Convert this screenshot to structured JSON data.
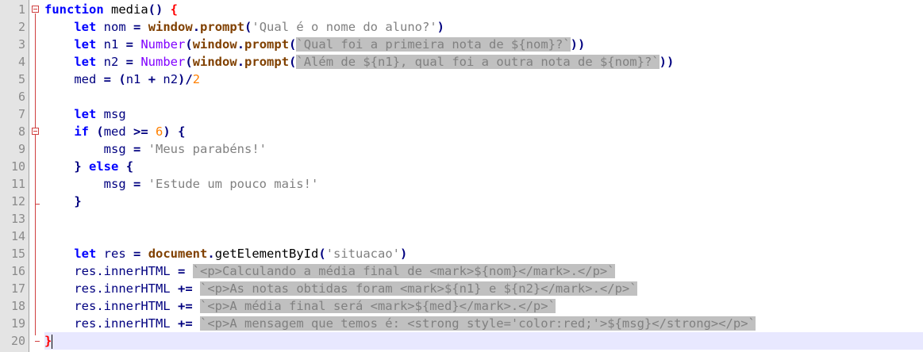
{
  "editor": {
    "line_numbers": [
      "1",
      "2",
      "3",
      "4",
      "5",
      "6",
      "7",
      "8",
      "9",
      "10",
      "11",
      "12",
      "13",
      "14",
      "15",
      "16",
      "17",
      "18",
      "19",
      "20"
    ],
    "lines": {
      "l1": {
        "kw": "function",
        "name": " media",
        "paren": "()",
        "space": " ",
        "brace": "{"
      },
      "l2": {
        "indent": "    ",
        "kw": "let",
        "decl": " nom ",
        "eq": "=",
        "space": " ",
        "obj": "window",
        "dot": ".",
        "method": "prompt",
        "open": "(",
        "str": "'Qual é o nome do aluno?'",
        "close": ")"
      },
      "l3": {
        "indent": "    ",
        "kw": "let",
        "decl": " n1 ",
        "eq": "=",
        "space": " ",
        "type": "Number",
        "open": "(",
        "obj": "window",
        "dot": ".",
        "method": "prompt",
        "open2": "(",
        "str": "`Qual foi a primeira nota de ${nom}?`",
        "close": "))"
      },
      "l4": {
        "indent": "    ",
        "kw": "let",
        "decl": " n2 ",
        "eq": "=",
        "space": " ",
        "type": "Number",
        "open": "(",
        "obj": "window",
        "dot": ".",
        "method": "prompt",
        "open2": "(",
        "str": "`Além de ${n1}, qual foi a outra nota de ${nom}?`",
        "close": "))"
      },
      "l5": {
        "indent": "    ",
        "decl": "med ",
        "eq": "=",
        "space": " ",
        "open": "(",
        "n1": "n1 ",
        "plus": "+",
        "n2": " n2",
        "close": ")",
        "div": "/",
        "num": "2"
      },
      "l7": {
        "indent": "    ",
        "kw": "let",
        "decl": " msg"
      },
      "l8": {
        "indent": "    ",
        "kw": "if",
        "space": " ",
        "open": "(",
        "var": "med ",
        "op": ">=",
        "space2": " ",
        "num": "6",
        "close": ")",
        "space3": " ",
        "brace": "{"
      },
      "l9": {
        "indent": "        ",
        "decl": "msg ",
        "eq": "=",
        "space": " ",
        "str": "'Meus parabéns!'"
      },
      "l10": {
        "indent": "    ",
        "brace1": "}",
        "space": " ",
        "kw": "else",
        "space2": " ",
        "brace2": "{"
      },
      "l11": {
        "indent": "        ",
        "decl": "msg ",
        "eq": "=",
        "space": " ",
        "str": "'Estude um pouco mais!'"
      },
      "l12": {
        "indent": "    ",
        "brace": "}"
      },
      "l15": {
        "indent": "    ",
        "kw": "let",
        "decl": " res ",
        "eq": "=",
        "space": " ",
        "obj": "document",
        "dot": ".",
        "method": "getElementById",
        "open": "(",
        "str": "'situacao'",
        "close": ")"
      },
      "l16": {
        "indent": "    ",
        "decl": "res.innerHTML ",
        "eq": "=",
        "space": " ",
        "str": "`<p>Calculando a média final de <mark>${nom}</mark>.</p>`"
      },
      "l17": {
        "indent": "    ",
        "decl": "res.innerHTML ",
        "eq": "+=",
        "space": " ",
        "str": "`<p>As notas obtidas foram <mark>${n1} e ${n2}</mark>.</p>`"
      },
      "l18": {
        "indent": "    ",
        "decl": "res.innerHTML ",
        "eq": "+=",
        "space": " ",
        "str": "`<p>A média final será <mark>${med}</mark>.</p>`"
      },
      "l19": {
        "indent": "    ",
        "decl": "res.innerHTML ",
        "eq": "+=",
        "space": " ",
        "str": "`<p>A mensagem que temos é: <strong style='color:red;'>${msg}</strong></p>`"
      },
      "l20": {
        "brace": "}"
      }
    }
  },
  "colors": {
    "keyword": "#0000ff",
    "string": "#808080",
    "number": "#ff8000",
    "object": "#804000",
    "number_type": "#8000ff",
    "selection": "#c0c0c0",
    "brace_match": "#ff0000",
    "gutter": "#e4e4e4",
    "caret_line": "#e8e8ff"
  },
  "icons": [
    "fold-minus-icon",
    "fold-line-icon"
  ]
}
